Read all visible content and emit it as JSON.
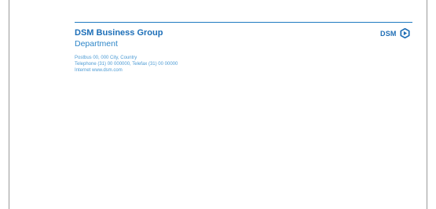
{
  "letterhead": {
    "company": "DSM Business Group",
    "department": "Department",
    "address_lines": [
      "Postbus 00, 000  City, Country",
      "Telephone (31) 00 000000, Telefax (31) 00 00000",
      "Internet www.dsm.com"
    ],
    "logo_text": "DSM",
    "logo_icon": "dsm-logo-mark-icon"
  },
  "colors": {
    "brand_blue": "#1d6fb8",
    "light_blue": "#4d9bd4",
    "page_border": "#9a9a9a"
  }
}
